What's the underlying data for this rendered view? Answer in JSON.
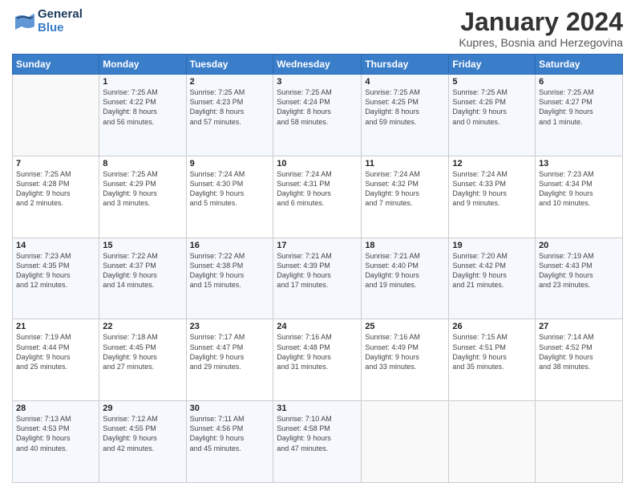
{
  "logo": {
    "line1": "General",
    "line2": "Blue"
  },
  "title": "January 2024",
  "subtitle": "Kupres, Bosnia and Herzegovina",
  "days_header": [
    "Sunday",
    "Monday",
    "Tuesday",
    "Wednesday",
    "Thursday",
    "Friday",
    "Saturday"
  ],
  "weeks": [
    [
      {
        "day": "",
        "info": ""
      },
      {
        "day": "1",
        "info": "Sunrise: 7:25 AM\nSunset: 4:22 PM\nDaylight: 8 hours\nand 56 minutes."
      },
      {
        "day": "2",
        "info": "Sunrise: 7:25 AM\nSunset: 4:23 PM\nDaylight: 8 hours\nand 57 minutes."
      },
      {
        "day": "3",
        "info": "Sunrise: 7:25 AM\nSunset: 4:24 PM\nDaylight: 8 hours\nand 58 minutes."
      },
      {
        "day": "4",
        "info": "Sunrise: 7:25 AM\nSunset: 4:25 PM\nDaylight: 8 hours\nand 59 minutes."
      },
      {
        "day": "5",
        "info": "Sunrise: 7:25 AM\nSunset: 4:26 PM\nDaylight: 9 hours\nand 0 minutes."
      },
      {
        "day": "6",
        "info": "Sunrise: 7:25 AM\nSunset: 4:27 PM\nDaylight: 9 hours\nand 1 minute."
      }
    ],
    [
      {
        "day": "7",
        "info": "Sunrise: 7:25 AM\nSunset: 4:28 PM\nDaylight: 9 hours\nand 2 minutes."
      },
      {
        "day": "8",
        "info": "Sunrise: 7:25 AM\nSunset: 4:29 PM\nDaylight: 9 hours\nand 3 minutes."
      },
      {
        "day": "9",
        "info": "Sunrise: 7:24 AM\nSunset: 4:30 PM\nDaylight: 9 hours\nand 5 minutes."
      },
      {
        "day": "10",
        "info": "Sunrise: 7:24 AM\nSunset: 4:31 PM\nDaylight: 9 hours\nand 6 minutes."
      },
      {
        "day": "11",
        "info": "Sunrise: 7:24 AM\nSunset: 4:32 PM\nDaylight: 9 hours\nand 7 minutes."
      },
      {
        "day": "12",
        "info": "Sunrise: 7:24 AM\nSunset: 4:33 PM\nDaylight: 9 hours\nand 9 minutes."
      },
      {
        "day": "13",
        "info": "Sunrise: 7:23 AM\nSunset: 4:34 PM\nDaylight: 9 hours\nand 10 minutes."
      }
    ],
    [
      {
        "day": "14",
        "info": "Sunrise: 7:23 AM\nSunset: 4:35 PM\nDaylight: 9 hours\nand 12 minutes."
      },
      {
        "day": "15",
        "info": "Sunrise: 7:22 AM\nSunset: 4:37 PM\nDaylight: 9 hours\nand 14 minutes."
      },
      {
        "day": "16",
        "info": "Sunrise: 7:22 AM\nSunset: 4:38 PM\nDaylight: 9 hours\nand 15 minutes."
      },
      {
        "day": "17",
        "info": "Sunrise: 7:21 AM\nSunset: 4:39 PM\nDaylight: 9 hours\nand 17 minutes."
      },
      {
        "day": "18",
        "info": "Sunrise: 7:21 AM\nSunset: 4:40 PM\nDaylight: 9 hours\nand 19 minutes."
      },
      {
        "day": "19",
        "info": "Sunrise: 7:20 AM\nSunset: 4:42 PM\nDaylight: 9 hours\nand 21 minutes."
      },
      {
        "day": "20",
        "info": "Sunrise: 7:19 AM\nSunset: 4:43 PM\nDaylight: 9 hours\nand 23 minutes."
      }
    ],
    [
      {
        "day": "21",
        "info": "Sunrise: 7:19 AM\nSunset: 4:44 PM\nDaylight: 9 hours\nand 25 minutes."
      },
      {
        "day": "22",
        "info": "Sunrise: 7:18 AM\nSunset: 4:45 PM\nDaylight: 9 hours\nand 27 minutes."
      },
      {
        "day": "23",
        "info": "Sunrise: 7:17 AM\nSunset: 4:47 PM\nDaylight: 9 hours\nand 29 minutes."
      },
      {
        "day": "24",
        "info": "Sunrise: 7:16 AM\nSunset: 4:48 PM\nDaylight: 9 hours\nand 31 minutes."
      },
      {
        "day": "25",
        "info": "Sunrise: 7:16 AM\nSunset: 4:49 PM\nDaylight: 9 hours\nand 33 minutes."
      },
      {
        "day": "26",
        "info": "Sunrise: 7:15 AM\nSunset: 4:51 PM\nDaylight: 9 hours\nand 35 minutes."
      },
      {
        "day": "27",
        "info": "Sunrise: 7:14 AM\nSunset: 4:52 PM\nDaylight: 9 hours\nand 38 minutes."
      }
    ],
    [
      {
        "day": "28",
        "info": "Sunrise: 7:13 AM\nSunset: 4:53 PM\nDaylight: 9 hours\nand 40 minutes."
      },
      {
        "day": "29",
        "info": "Sunrise: 7:12 AM\nSunset: 4:55 PM\nDaylight: 9 hours\nand 42 minutes."
      },
      {
        "day": "30",
        "info": "Sunrise: 7:11 AM\nSunset: 4:56 PM\nDaylight: 9 hours\nand 45 minutes."
      },
      {
        "day": "31",
        "info": "Sunrise: 7:10 AM\nSunset: 4:58 PM\nDaylight: 9 hours\nand 47 minutes."
      },
      {
        "day": "",
        "info": ""
      },
      {
        "day": "",
        "info": ""
      },
      {
        "day": "",
        "info": ""
      }
    ]
  ]
}
